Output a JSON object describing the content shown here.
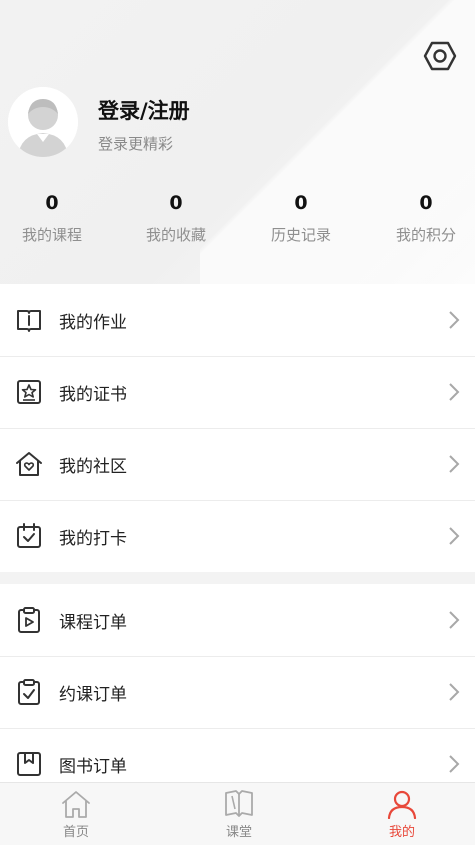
{
  "header": {
    "login_title": "登录/注册",
    "login_subtitle": "登录更精彩"
  },
  "stats": [
    {
      "value": "0",
      "label": "我的课程"
    },
    {
      "value": "0",
      "label": "我的收藏"
    },
    {
      "value": "0",
      "label": "历史记录"
    },
    {
      "value": "0",
      "label": "我的积分"
    }
  ],
  "menu_primary": [
    {
      "label": "我的作业",
      "icon": "book-icon"
    },
    {
      "label": "我的证书",
      "icon": "certificate-icon"
    },
    {
      "label": "我的社区",
      "icon": "house-heart-icon"
    },
    {
      "label": "我的打卡",
      "icon": "calendar-check-icon"
    }
  ],
  "menu_orders": [
    {
      "label": "课程订单",
      "icon": "clipboard-play-icon"
    },
    {
      "label": "约课订单",
      "icon": "clipboard-check-icon"
    },
    {
      "label": "图书订单",
      "icon": "bookmark-icon"
    }
  ],
  "tabbar": [
    {
      "label": "首页",
      "icon": "home-icon"
    },
    {
      "label": "课堂",
      "icon": "open-book-icon"
    },
    {
      "label": "我的",
      "icon": "person-icon",
      "active": true
    }
  ],
  "colors": {
    "accent": "#e8483a",
    "icon": "#333333",
    "muted": "#8f8f8f"
  }
}
